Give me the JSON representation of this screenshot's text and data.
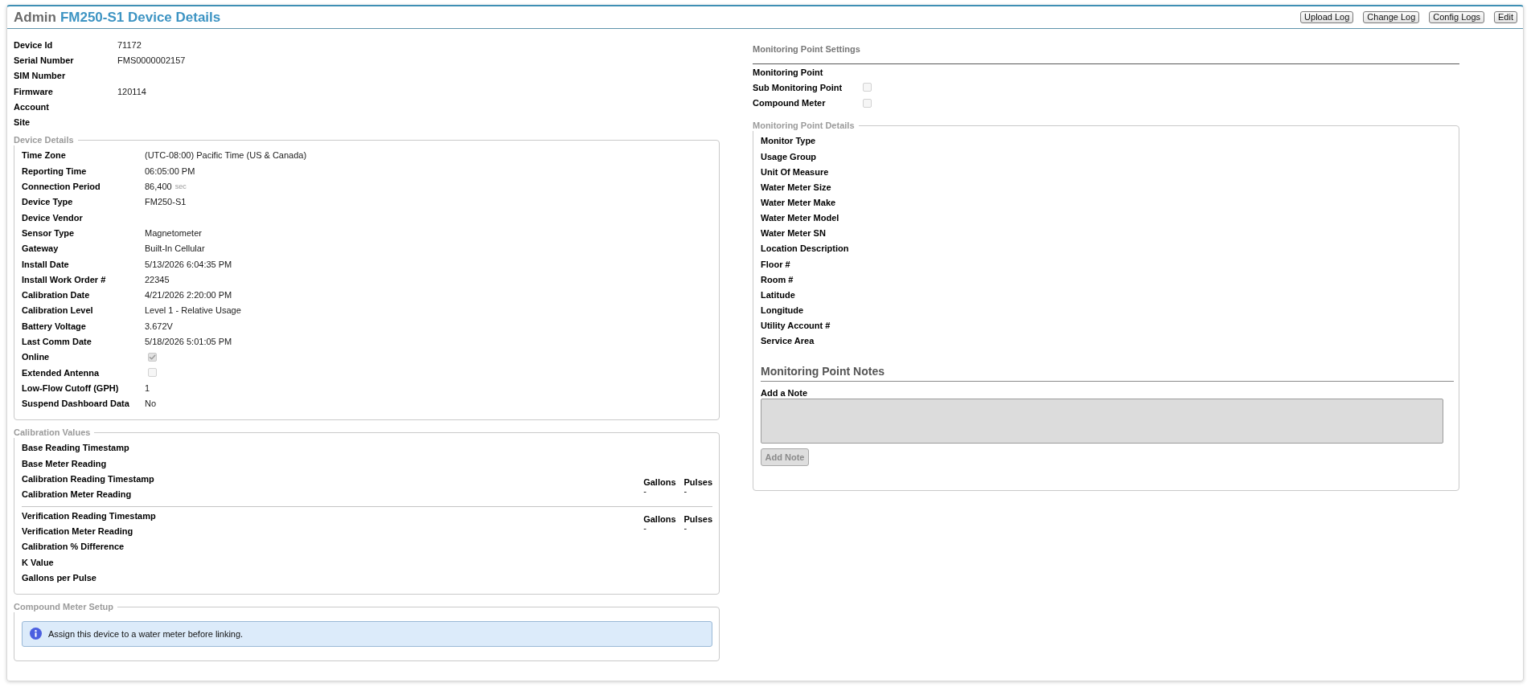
{
  "header": {
    "prefix": "Admin",
    "title": "FM250-S1 Device Details"
  },
  "actions": [
    "Upload Log",
    "Change Log",
    "Config Logs",
    "Edit"
  ],
  "device_info": [
    {
      "label": "Device Id",
      "value": "71172"
    },
    {
      "label": "Serial Number",
      "value": "FMS0000002157"
    },
    {
      "label": "SIM Number"
    },
    {
      "label": "Firmware",
      "value": "120114"
    },
    {
      "label": "Account"
    },
    {
      "label": "Site"
    }
  ],
  "device_details": {
    "legend": "Device Details",
    "rows": [
      {
        "kind": "text",
        "label": "Time Zone",
        "value": "(UTC-08:00) Pacific Time (US & Canada)"
      },
      {
        "kind": "text",
        "label": "Reporting Time",
        "value": "06:05:00 PM"
      },
      {
        "kind": "text",
        "label": "Connection Period",
        "value": "86,400",
        "unit": "sec"
      },
      {
        "kind": "text",
        "label": "Device Type",
        "value": "FM250-S1"
      },
      {
        "kind": "text",
        "label": "Device Vendor"
      },
      {
        "kind": "text",
        "label": "Sensor Type",
        "value": "Magnetometer"
      },
      {
        "kind": "text",
        "label": "Gateway",
        "value": "Built-In Cellular"
      },
      {
        "kind": "text",
        "label": "Install Date",
        "value": "5/13/2026 6:04:35 PM"
      },
      {
        "kind": "text",
        "label": "Install Work Order #",
        "value": "22345"
      },
      {
        "kind": "text",
        "label": "Calibration Date",
        "value": "4/21/2026 2:20:00 PM"
      },
      {
        "kind": "text",
        "label": "Calibration Level",
        "value": "Level 1 - Relative Usage"
      },
      {
        "kind": "text",
        "label": "Battery Voltage",
        "value": "3.672V"
      },
      {
        "kind": "text",
        "label": "Last Comm Date",
        "value": "5/18/2026 5:01:05 PM"
      },
      {
        "kind": "checkbox",
        "label": "Online",
        "checked": true,
        "disabled": true
      },
      {
        "kind": "checkbox",
        "label": "Extended Antenna",
        "checked": false,
        "disabled": true
      },
      {
        "kind": "text",
        "label": "Low-Flow Cutoff (GPH)",
        "value": "1"
      },
      {
        "kind": "text",
        "label": "Suspend Dashboard Data",
        "value": "No"
      }
    ]
  },
  "calibration_values": {
    "legend": "Calibration Values",
    "blocks": [
      {
        "kind": "group",
        "rows": [
          "Base Reading Timestamp",
          "Base Meter Reading"
        ]
      },
      {
        "kind": "group",
        "rows": [
          "Calibration Reading Timestamp",
          "Calibration Meter Reading"
        ],
        "readings": [
          {
            "label": "Gallons",
            "value": "-"
          },
          {
            "label": "Pulses",
            "value": "-"
          }
        ]
      },
      {
        "kind": "divider"
      },
      {
        "kind": "group",
        "rows": [
          "Verification Reading Timestamp",
          "Verification Meter Reading"
        ],
        "readings": [
          {
            "label": "Gallons",
            "value": "-"
          },
          {
            "label": "Pulses",
            "value": "-"
          }
        ]
      },
      {
        "kind": "group",
        "rows": [
          "Calibration % Difference",
          "K Value",
          "Gallons per Pulse"
        ]
      }
    ]
  },
  "compound_meter_setup": {
    "legend": "Compound Meter Setup",
    "alert": {
      "kind": "info",
      "text": "Assign this device to a water meter before linking."
    }
  },
  "monitoring_point_settings": {
    "title": "Monitoring Point Settings",
    "rows": [
      {
        "kind": "text",
        "label": "Monitoring Point"
      },
      {
        "kind": "checkbox",
        "label": "Sub Monitoring Point",
        "checked": false,
        "disabled": true
      },
      {
        "kind": "checkbox",
        "label": "Compound Meter",
        "checked": false,
        "disabled": true
      }
    ]
  },
  "monitoring_point_details": {
    "legend": "Monitoring Point Details",
    "rows": [
      "Monitor Type",
      "Usage Group",
      "Unit Of Measure",
      "Water Meter Size",
      "Water Meter Make",
      "Water Meter Model",
      "Water Meter SN",
      "Location Description",
      "Floor #",
      "Room #",
      "Latitude",
      "Longitude",
      "Utility Account #",
      "Service Area"
    ],
    "notes": {
      "title": "Monitoring Point Notes",
      "field_label": "Add a Note",
      "field": {
        "disabled": true
      },
      "button": {
        "label": "Add Note",
        "disabled": true
      }
    }
  }
}
